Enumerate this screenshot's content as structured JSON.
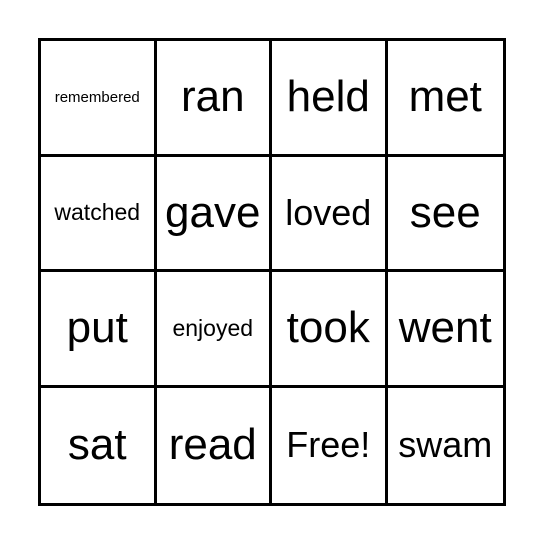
{
  "card": {
    "cells": [
      "remembered",
      "ran",
      "held",
      "met",
      "watched",
      "gave",
      "loved",
      "see",
      "put",
      "enjoyed",
      "took",
      "went",
      "sat",
      "read",
      "Free!",
      "swam"
    ]
  }
}
